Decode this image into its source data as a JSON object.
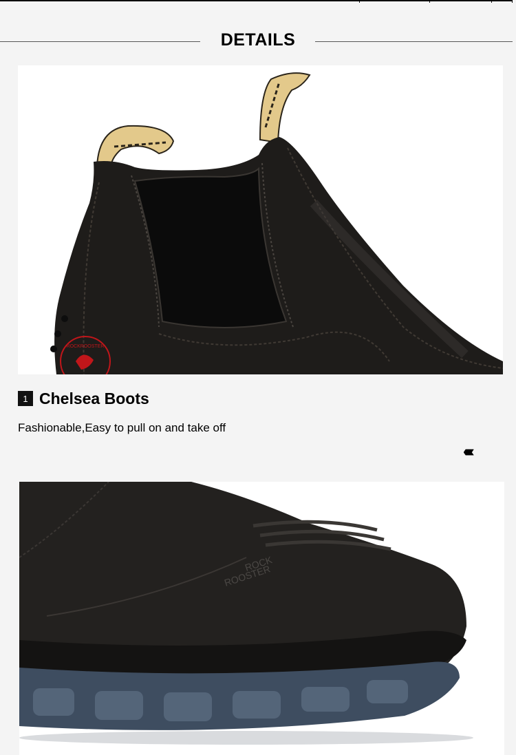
{
  "section": {
    "title": "DETAILS"
  },
  "features": [
    {
      "number": "1",
      "heading": "Chelsea Boots",
      "description": "Fashionable,Easy to pull on and take off"
    }
  ],
  "navigation": {
    "arrows": "‹‹‹‹‹"
  },
  "images": [
    {
      "name": "chelsea-boot-side-photo",
      "brand_badge": "ROCKROOSTER"
    },
    {
      "name": "boot-toe-photo",
      "embossing": [
        "ROCK",
        "ROOSTER"
      ]
    }
  ],
  "colors": {
    "background": "#f4f4f4",
    "leather": "#1c1a18",
    "pull_tab": "#e2c98a",
    "sole": "#3e4d60",
    "brand_red": "#c0161a"
  }
}
